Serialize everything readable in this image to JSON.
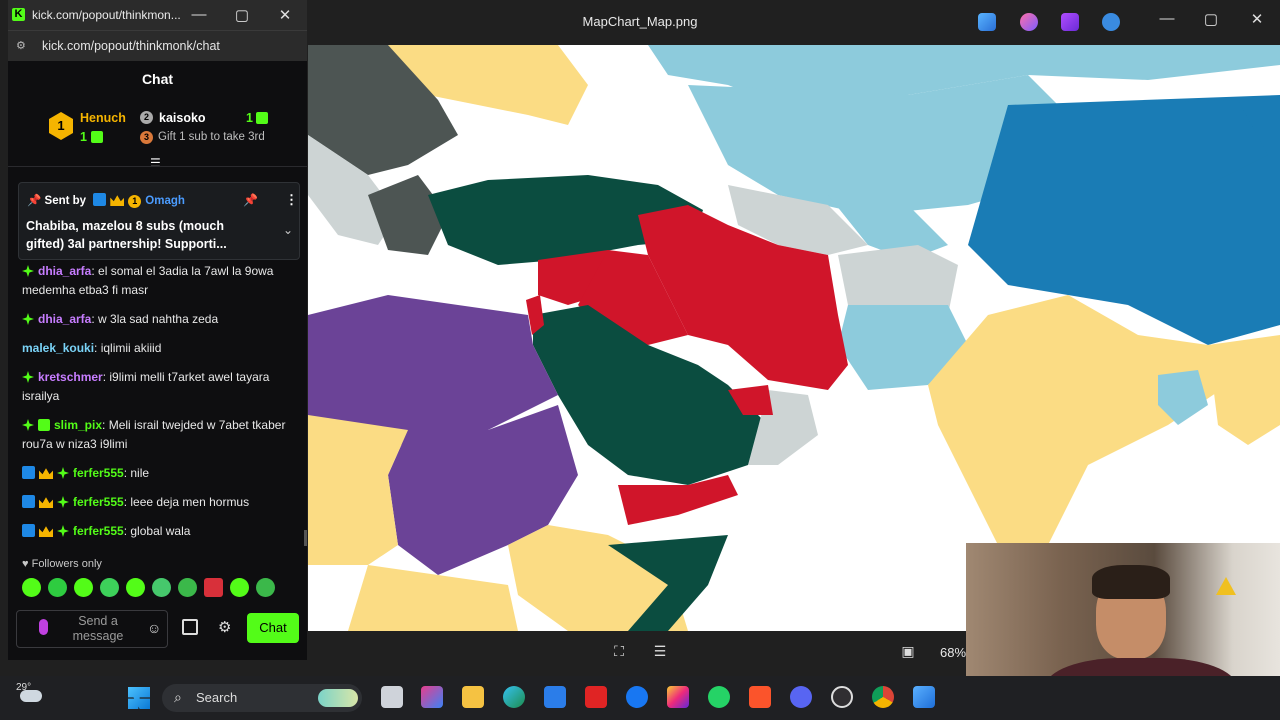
{
  "viewer": {
    "title": "MapChart_Map.png",
    "zoom": "68%",
    "controls": {
      "minimize": "—",
      "maximize": "▢",
      "close": "✕"
    }
  },
  "chat_window": {
    "title": "kick.com/popout/thinkmon...",
    "url": "kick.com/popout/thinkmonk/chat",
    "header": "Chat",
    "leaderboard": {
      "first": {
        "rank": "1",
        "name": "Henuch",
        "count": "1"
      },
      "second": {
        "rank": "2",
        "name": "kaisoko",
        "count": "1"
      },
      "third": {
        "rank": "3",
        "hint": "Gift 1 sub to take 3rd"
      }
    },
    "pinned": {
      "sent_by": "Sent by",
      "sender": "Omagh",
      "sender_badge": "1",
      "message": "Chabiba, mazelou 8 subs (mouch gifted) 3al partnership! Supporti..."
    },
    "messages": [
      {
        "user": "dhia_arfa",
        "color": "#c77dff",
        "badges": [
          "green"
        ],
        "text": "el somal el 3adia la 7awl la 9owa medemha etba3 fi masr"
      },
      {
        "user": "dhia_arfa",
        "color": "#c77dff",
        "badges": [
          "green"
        ],
        "text": "w 3la sad nahtha zeda"
      },
      {
        "user": "malek_kouki",
        "color": "#7ad3f7",
        "badges": [],
        "text": "iqlimii akiiid"
      },
      {
        "user": "kretschmer",
        "color": "#c77dff",
        "badges": [
          "green"
        ],
        "text": "i9limi melli t7arket awel tayara israilya"
      },
      {
        "user": "slim_pix",
        "color": "#53fc18",
        "badges": [
          "green",
          "sub"
        ],
        "text": "Meli israil twejded w 7abet tkaber rou7a w niza3 i9limi"
      },
      {
        "user": "ferfer555",
        "color": "#53fc18",
        "badges": [
          "blue",
          "crown",
          "green"
        ],
        "text": "nile"
      },
      {
        "user": "ferfer555",
        "color": "#53fc18",
        "badges": [
          "blue",
          "crown",
          "green"
        ],
        "text": "leee deja men hormus"
      },
      {
        "user": "ferfer555",
        "color": "#53fc18",
        "badges": [
          "blue",
          "crown",
          "green"
        ],
        "text": "global wala"
      }
    ],
    "followers_only": "Followers only",
    "input_placeholder": "Send a message",
    "chat_button": "Chat"
  },
  "taskbar": {
    "weather": "29°",
    "search": "Search"
  },
  "colors": {
    "kick_green": "#53fc18",
    "map_teal": "#0b4d40",
    "map_red": "#d0152a",
    "map_purple": "#6b4397",
    "map_yellow": "#fbdc84",
    "map_lightblue": "#8dcbdc",
    "map_blue": "#1a7cb5",
    "map_grey": "#cdd4d4",
    "map_dark": "#4d5553"
  }
}
